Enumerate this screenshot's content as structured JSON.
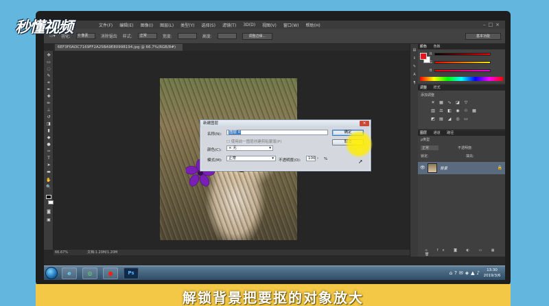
{
  "watermark": {
    "logo_text": "秒懂视频"
  },
  "app": {
    "menu": [
      "文件(F)",
      "编辑(E)",
      "图像(I)",
      "图层(L)",
      "类型(Y)",
      "选择(S)",
      "滤镜(T)",
      "3D(D)",
      "视图(V)",
      "窗口(W)",
      "帮助(H)"
    ],
    "options": {
      "feather_label": "羽化:",
      "feather_value": "0 像素",
      "antialias_label": "消除锯齿",
      "style_label": "样式:",
      "style_value": "正常",
      "width_label": "宽度:",
      "height_label": "高度:",
      "refine_button": "调整边缘...",
      "workspace": "基本功能"
    },
    "document_tab": "6EF3F0ADC7169FF2A25BA9E80998194.jpg @ 66.7%(RGB/8#)",
    "status": {
      "zoom": "66.67%",
      "doc_size": "文档:1.20M/1.20M"
    }
  },
  "dialog": {
    "title": "新建图层",
    "name_label": "名称(N):",
    "name_value": "图层 0",
    "clip_checkbox": "使用前一图层创建剪贴蒙版(P)",
    "color_label": "颜色(C):",
    "color_value": "无",
    "mode_label": "模式(M):",
    "mode_value": "正常",
    "opacity_label": "不透明度(O):",
    "opacity_value": "100",
    "opacity_unit": "%",
    "ok_button": "确定",
    "cancel_button": "取消"
  },
  "panels": {
    "color_tabs": [
      "颜色",
      "色板"
    ],
    "color_channels": [
      "R",
      "G",
      "B"
    ],
    "adjust_tabs": [
      "调整",
      "样式"
    ],
    "adjust_title": "添加调整",
    "layers_tabs": [
      "图层",
      "通道",
      "路径"
    ],
    "kind_label": "ρ类型",
    "blend_mode": "正常",
    "opacity_label": "不透明度:",
    "lock_label": "锁定:",
    "fill_label": "填充:",
    "layer_name": "背景"
  },
  "taskbar": {
    "apps": [
      "e",
      "◎",
      "●",
      "Ps"
    ],
    "time": "13:30",
    "date": "2019/3/6"
  },
  "caption": "解锁背景把要抠的对象放大"
}
